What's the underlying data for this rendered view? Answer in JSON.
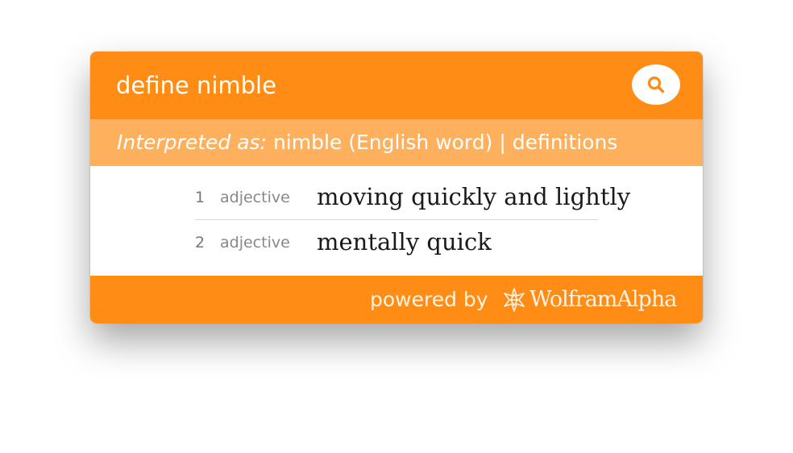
{
  "query": {
    "text": "define nimble",
    "search_icon": "search-icon"
  },
  "interpretation": {
    "label": "Interpreted as:",
    "value": "nimble (English word) | definitions"
  },
  "definitions": [
    {
      "number": "1",
      "part_of_speech": "adjective",
      "meaning": "moving quickly and lightly"
    },
    {
      "number": "2",
      "part_of_speech": "adjective",
      "meaning": "mentally quick"
    }
  ],
  "footer": {
    "powered_by": "powered by",
    "brand": "WolframAlpha",
    "logo_icon": "wolfram-spikey-icon"
  },
  "colors": {
    "accent": "#ff8c14",
    "accent_light": "#ffb05c"
  }
}
